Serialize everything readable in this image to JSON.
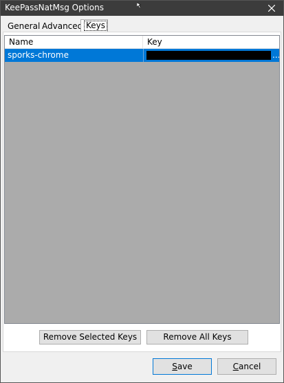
{
  "window": {
    "title": "KeePassNatMsg Options"
  },
  "tabs": [
    {
      "label": "General"
    },
    {
      "label": "Advanced"
    },
    {
      "label": "Keys",
      "selected": true
    }
  ],
  "keys_list": {
    "columns": [
      "Name",
      "Key"
    ],
    "rows": [
      {
        "name": "sporks-chrome",
        "key_ellipsis": "...",
        "selected": true
      }
    ]
  },
  "buttons": {
    "remove_selected": "Remove Selected Keys",
    "remove_all": "Remove All Keys",
    "save_rest": "ave",
    "save_mnemonic": "S",
    "cancel_mnemonic": "C",
    "cancel_rest": "ancel"
  },
  "icons": {
    "close": "close-icon",
    "cursor": "mouse-cursor-icon"
  },
  "colors": {
    "titlebar": "#3c3c3c",
    "selection": "#0078d7",
    "list_background": "#ababab"
  }
}
